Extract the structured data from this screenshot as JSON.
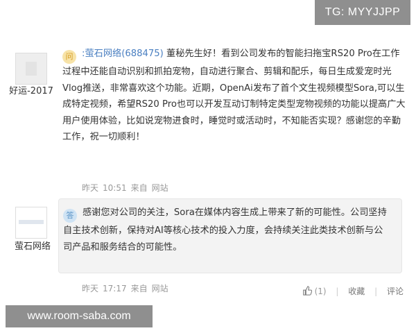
{
  "watermarks": {
    "top": "TG: MYYJJPP",
    "bottom": "www.room-saba.com"
  },
  "question": {
    "user_name": "好运-2017",
    "badge": "问",
    "asker": ":萤石网络(688475)",
    "text": "董秘先生好！看到公司发布的智能扫拖宝RS20 Pro在工作过程中还能自动识别和抓拍宠物，自动进行聚合、剪辑和配乐，每日生成爱宠时光Vlog推送，非常喜欢这个功能。近期，OpenAi发布了首个文生视频模型Sora,可以生成特定视频，希望RS20 Pro也可以开发互动订制特定类型宠物视频的功能以提高广大用户使用体验，比如说宠物进食时，睡觉时或活动时，不知能否实现？感谢您的辛勤工作，祝一切顺利！",
    "meta": {
      "day": "昨天",
      "time": "10:51",
      "from": "来自",
      "source": "网站"
    }
  },
  "answer": {
    "user_name": "萤石网络",
    "badge": "答",
    "text": "感谢您对公司的关注，Sora在媒体内容生成上带来了新的可能性。公司坚持自主技术创新，保持对AI等核心技术的投入力度，会持续关注此类技术创新与公司产品和服务结合的可能性。",
    "meta": {
      "day": "昨天",
      "time": "17:17",
      "from": "来自",
      "source": "网站"
    }
  },
  "actions": {
    "like_count": "(1)",
    "favorite": "收藏",
    "comment": "评论"
  },
  "icons": {
    "like": "thumbs-up-icon"
  }
}
